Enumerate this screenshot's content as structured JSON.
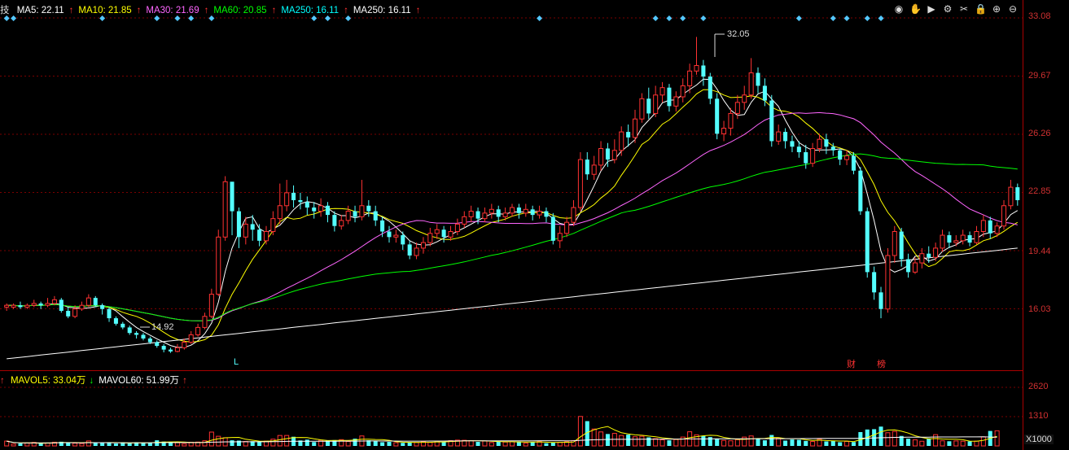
{
  "legend": {
    "prefix": "技",
    "items": [
      {
        "label": "MA5: 22.11",
        "arrow": "↑",
        "color": "#ffffff"
      },
      {
        "label": "MA10: 21.85",
        "arrow": "↑",
        "color": "#ffff00"
      },
      {
        "label": "MA30: 21.69",
        "arrow": "↑",
        "color": "#ff66ff"
      },
      {
        "label": "MA60: 20.85",
        "arrow": "↑",
        "color": "#00ff00"
      },
      {
        "label": "MA250: 16.11",
        "arrow": "↑",
        "color": "#00ffff"
      },
      {
        "label": "MA250: 16.11",
        "arrow": "↑",
        "color": "#ffffff"
      }
    ]
  },
  "vol_legend": {
    "items": [
      {
        "label": "MAVOL5: 33.04万",
        "arrow": "↓",
        "color": "#ffff00"
      },
      {
        "label": "MAVOL60: 51.99万",
        "arrow": "↑",
        "color": "#ffffff"
      }
    ]
  },
  "toolbar": [
    "eye-icon",
    "hand-icon",
    "play-icon",
    "settings-icon",
    "scissors-icon",
    "lock-icon",
    "zoom-in-icon",
    "zoom-out-icon"
  ],
  "price_axis": [
    "33.08",
    "29.67",
    "26.26",
    "22.85",
    "19.44",
    "16.03"
  ],
  "vol_axis": [
    "2620",
    "1310"
  ],
  "vol_unit": "X1000",
  "annotations": {
    "high": "32.05",
    "low": "14.92"
  },
  "event_marks": {
    "l": "L",
    "cai": "财",
    "bang": "榜"
  },
  "colors": {
    "up": "#ff3232",
    "down": "#54ffff",
    "ma5": "#ffffff",
    "ma10": "#ffff00",
    "ma30": "#ff66ff",
    "ma60": "#00ff00",
    "ma250": "#ffffff"
  },
  "chart_data": {
    "type": "candlestick",
    "ylim": [
      14.2,
      33.08
    ],
    "grid": true,
    "candles": [
      [
        17.4,
        17.5,
        17.6,
        17.2
      ],
      [
        17.4,
        17.5,
        17.6,
        17.3
      ],
      [
        17.5,
        17.4,
        17.7,
        17.3
      ],
      [
        17.4,
        17.5,
        17.6,
        17.3
      ],
      [
        17.5,
        17.6,
        17.8,
        17.4
      ],
      [
        17.6,
        17.5,
        17.7,
        17.3
      ],
      [
        17.5,
        17.6,
        17.9,
        17.4
      ],
      [
        17.6,
        17.8,
        18.0,
        17.5
      ],
      [
        17.8,
        17.2,
        17.9,
        17.1
      ],
      [
        17.2,
        16.9,
        17.4,
        16.8
      ],
      [
        16.9,
        17.3,
        17.5,
        16.8
      ],
      [
        17.3,
        17.5,
        17.7,
        17.2
      ],
      [
        17.5,
        17.9,
        18.1,
        17.4
      ],
      [
        17.9,
        17.5,
        18.0,
        17.4
      ],
      [
        17.5,
        17.3,
        17.6,
        17.0
      ],
      [
        17.3,
        16.8,
        17.4,
        16.6
      ],
      [
        16.8,
        16.5,
        16.9,
        16.4
      ],
      [
        16.5,
        16.3,
        16.6,
        16.2
      ],
      [
        16.3,
        16.0,
        16.4,
        15.9
      ],
      [
        16.0,
        15.9,
        16.1,
        15.7
      ],
      [
        15.9,
        15.7,
        16.0,
        15.6
      ],
      [
        15.7,
        15.5,
        15.8,
        15.4
      ],
      [
        15.5,
        15.3,
        15.6,
        15.2
      ],
      [
        15.3,
        15.1,
        15.4,
        14.95
      ],
      [
        15.1,
        15.0,
        15.2,
        14.92
      ],
      [
        15.0,
        15.2,
        15.4,
        14.95
      ],
      [
        15.2,
        15.5,
        15.7,
        15.1
      ],
      [
        15.5,
        15.9,
        16.1,
        15.4
      ],
      [
        15.9,
        16.3,
        16.5,
        15.8
      ],
      [
        16.3,
        16.9,
        17.1,
        16.2
      ],
      [
        16.9,
        18.1,
        18.4,
        16.8
      ],
      [
        18.1,
        21.2,
        21.6,
        18.0
      ],
      [
        21.2,
        24.2,
        24.5,
        21.0
      ],
      [
        24.2,
        22.6,
        23.2,
        21.3
      ],
      [
        22.6,
        21.2,
        22.8,
        20.6
      ],
      [
        21.2,
        21.9,
        22.3,
        20.8
      ],
      [
        21.9,
        21.6,
        22.4,
        21.0
      ],
      [
        21.6,
        21.0,
        21.9,
        20.7
      ],
      [
        21.0,
        21.5,
        21.8,
        20.8
      ],
      [
        21.5,
        22.2,
        22.6,
        21.3
      ],
      [
        22.2,
        22.9,
        24.1,
        21.9
      ],
      [
        22.9,
        23.6,
        24.3,
        22.6
      ],
      [
        23.6,
        23.2,
        24.0,
        22.8
      ],
      [
        23.2,
        23.1,
        23.6,
        22.7
      ],
      [
        23.1,
        22.8,
        23.4,
        22.4
      ],
      [
        22.8,
        22.6,
        23.1,
        22.2
      ],
      [
        22.6,
        22.9,
        23.3,
        22.3
      ],
      [
        22.9,
        22.4,
        23.1,
        22.0
      ],
      [
        22.4,
        21.8,
        22.6,
        21.5
      ],
      [
        21.8,
        22.1,
        22.4,
        21.6
      ],
      [
        22.1,
        22.6,
        22.9,
        21.9
      ],
      [
        22.6,
        22.3,
        22.9,
        22.0
      ],
      [
        22.3,
        22.9,
        24.3,
        22.1
      ],
      [
        22.9,
        22.6,
        23.2,
        22.3
      ],
      [
        22.6,
        22.1,
        22.9,
        21.8
      ],
      [
        22.1,
        21.5,
        22.3,
        21.2
      ],
      [
        21.5,
        21.2,
        21.8,
        20.9
      ],
      [
        21.2,
        21.3,
        21.6,
        20.9
      ],
      [
        21.3,
        20.8,
        21.5,
        20.5
      ],
      [
        20.8,
        20.2,
        21.0,
        20.0
      ],
      [
        20.2,
        20.6,
        20.9,
        20.0
      ],
      [
        20.6,
        20.9,
        21.2,
        20.3
      ],
      [
        20.9,
        21.4,
        21.7,
        20.7
      ],
      [
        21.4,
        21.6,
        21.9,
        21.1
      ],
      [
        21.6,
        21.2,
        21.8,
        20.9
      ],
      [
        21.2,
        21.5,
        21.8,
        21.0
      ],
      [
        21.5,
        21.9,
        22.2,
        21.3
      ],
      [
        21.9,
        22.3,
        22.6,
        21.7
      ],
      [
        22.3,
        22.6,
        22.9,
        22.0
      ],
      [
        22.6,
        22.2,
        22.8,
        21.9
      ],
      [
        22.2,
        22.5,
        22.8,
        22.0
      ],
      [
        22.5,
        22.7,
        23.0,
        22.2
      ],
      [
        22.7,
        22.3,
        22.9,
        22.0
      ],
      [
        22.3,
        22.5,
        22.8,
        22.1
      ],
      [
        22.5,
        22.8,
        23.0,
        22.3
      ],
      [
        22.8,
        22.5,
        23.0,
        22.2
      ],
      [
        22.5,
        22.7,
        23.0,
        22.3
      ],
      [
        22.7,
        22.4,
        22.9,
        22.1
      ],
      [
        22.4,
        22.6,
        22.9,
        22.2
      ],
      [
        22.6,
        22.3,
        22.8,
        22.0
      ],
      [
        22.3,
        21.0,
        22.5,
        20.8
      ],
      [
        21.0,
        21.4,
        21.8,
        20.6
      ],
      [
        21.4,
        22.0,
        22.3,
        21.2
      ],
      [
        22.0,
        22.8,
        23.2,
        21.8
      ],
      [
        22.8,
        25.4,
        25.8,
        22.6
      ],
      [
        25.4,
        24.6,
        25.8,
        24.3
      ],
      [
        24.6,
        25.1,
        25.6,
        24.3
      ],
      [
        25.1,
        26.0,
        26.4,
        24.8
      ],
      [
        26.0,
        25.4,
        26.3,
        25.0
      ],
      [
        25.4,
        25.9,
        26.5,
        25.2
      ],
      [
        25.9,
        26.9,
        27.2,
        25.6
      ],
      [
        26.9,
        26.6,
        27.3,
        26.1
      ],
      [
        26.6,
        27.6,
        28.1,
        26.3
      ],
      [
        27.6,
        28.7,
        29.0,
        27.4
      ],
      [
        28.7,
        27.9,
        29.3,
        27.6
      ],
      [
        27.9,
        28.9,
        29.4,
        27.7
      ],
      [
        28.9,
        29.3,
        29.6,
        28.5
      ],
      [
        29.3,
        28.3,
        29.5,
        28.0
      ],
      [
        28.3,
        28.8,
        29.1,
        28.0
      ],
      [
        28.8,
        29.4,
        29.8,
        28.5
      ],
      [
        29.4,
        30.2,
        30.6,
        29.0
      ],
      [
        30.2,
        30.5,
        32.05,
        30.0
      ],
      [
        30.5,
        29.9,
        30.8,
        29.4
      ],
      [
        29.9,
        28.7,
        30.1,
        28.4
      ],
      [
        28.7,
        26.8,
        29.0,
        26.5
      ],
      [
        26.8,
        27.1,
        27.5,
        26.4
      ],
      [
        27.1,
        27.9,
        28.2,
        26.7
      ],
      [
        27.9,
        28.5,
        28.9,
        27.6
      ],
      [
        28.5,
        28.9,
        29.4,
        28.1
      ],
      [
        28.9,
        30.1,
        30.9,
        28.7
      ],
      [
        30.1,
        29.4,
        30.4,
        29.0
      ],
      [
        29.4,
        28.6,
        29.8,
        28.3
      ],
      [
        28.6,
        26.4,
        28.9,
        26.1
      ],
      [
        26.4,
        26.9,
        27.3,
        26.2
      ],
      [
        26.9,
        26.4,
        27.1,
        26.0
      ],
      [
        26.4,
        26.1,
        26.7,
        25.8
      ],
      [
        26.1,
        25.8,
        26.4,
        25.5
      ],
      [
        25.8,
        25.2,
        26.2,
        24.9
      ],
      [
        25.2,
        26.0,
        26.3,
        25.0
      ],
      [
        26.0,
        26.5,
        26.8,
        25.8
      ],
      [
        26.5,
        26.1,
        26.8,
        25.7
      ],
      [
        26.1,
        25.9,
        26.3,
        25.6
      ],
      [
        25.9,
        25.4,
        26.0,
        25.1
      ],
      [
        25.4,
        25.6,
        25.9,
        25.1
      ],
      [
        25.6,
        24.8,
        25.8,
        24.6
      ],
      [
        24.8,
        22.6,
        25.0,
        22.4
      ],
      [
        22.6,
        19.3,
        22.8,
        19.0
      ],
      [
        19.3,
        18.2,
        19.6,
        17.8
      ],
      [
        18.2,
        17.3,
        18.5,
        16.8
      ],
      [
        17.3,
        20.2,
        20.6,
        17.1
      ],
      [
        20.2,
        21.5,
        21.8,
        19.8
      ],
      [
        21.5,
        20.0,
        21.7,
        19.6
      ],
      [
        20.0,
        19.3,
        20.3,
        19.0
      ],
      [
        19.3,
        19.8,
        20.1,
        19.2
      ],
      [
        19.8,
        20.3,
        20.6,
        19.5
      ],
      [
        20.3,
        20.1,
        20.7,
        19.8
      ],
      [
        20.1,
        20.6,
        20.9,
        19.9
      ],
      [
        20.6,
        21.3,
        21.6,
        20.4
      ],
      [
        21.3,
        20.9,
        21.5,
        20.6
      ],
      [
        20.9,
        21.0,
        21.3,
        20.7
      ],
      [
        21.0,
        21.3,
        21.6,
        20.8
      ],
      [
        21.3,
        20.9,
        21.5,
        20.7
      ],
      [
        20.9,
        21.5,
        21.8,
        20.8
      ],
      [
        21.5,
        22.1,
        22.4,
        21.2
      ],
      [
        22.1,
        21.4,
        22.3,
        21.1
      ],
      [
        21.4,
        21.8,
        22.0,
        21.2
      ],
      [
        21.8,
        22.9,
        23.2,
        21.6
      ],
      [
        22.9,
        23.9,
        24.3,
        22.7
      ],
      [
        23.9,
        23.2,
        24.1,
        22.9
      ]
    ],
    "volume": [
      300,
      120,
      150,
      180,
      220,
      160,
      180,
      230,
      260,
      200,
      170,
      150,
      310,
      190,
      200,
      180,
      150,
      230,
      160,
      230,
      180,
      190,
      350,
      270,
      260,
      200,
      130,
      230,
      240,
      320,
      860,
      600,
      510,
      350,
      330,
      280,
      290,
      250,
      300,
      420,
      650,
      650,
      570,
      340,
      390,
      240,
      350,
      350,
      360,
      390,
      280,
      450,
      620,
      350,
      300,
      230,
      250,
      200,
      190,
      230,
      220,
      270,
      220,
      290,
      250,
      330,
      360,
      350,
      330,
      250,
      310,
      210,
      270,
      240,
      260,
      270,
      180,
      240,
      290,
      170,
      200,
      220,
      260,
      330,
      1830,
      1540,
      1050,
      870,
      740,
      780,
      650,
      700,
      570,
      600,
      530,
      450,
      380,
      350,
      400,
      550,
      880,
      690,
      630,
      550,
      450,
      340,
      320,
      390,
      550,
      620,
      430,
      350,
      680,
      490,
      330,
      400,
      380,
      310,
      280,
      420,
      280,
      310,
      230,
      280,
      240,
      860,
      1020,
      1040,
      1200,
      820,
      900,
      620,
      450,
      380,
      290,
      470,
      700,
      320,
      290,
      310,
      290,
      280,
      300,
      560,
      930,
      940
    ]
  }
}
